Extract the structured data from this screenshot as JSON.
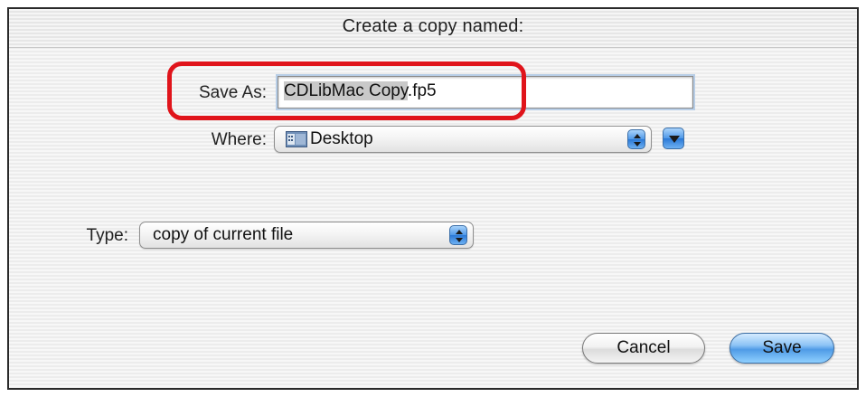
{
  "dialog": {
    "title": "Create a copy named:"
  },
  "save_as": {
    "label": "Save As:",
    "name_selected": "CDLibMac Copy",
    "name_extension": ".fp5"
  },
  "where": {
    "label": "Where:",
    "value": "Desktop",
    "icon": "desktop-folder-icon"
  },
  "type": {
    "label": "Type:",
    "value": "copy of current file"
  },
  "buttons": {
    "cancel": "Cancel",
    "save": "Save"
  },
  "colors": {
    "highlight_ring": "#e0141b",
    "aqua_blue": "#4f9be6"
  }
}
